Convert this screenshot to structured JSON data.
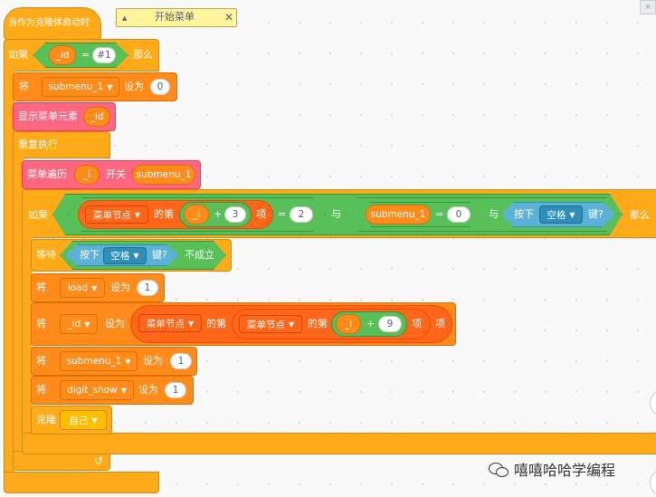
{
  "top_right_icon": "close-icon",
  "hat": {
    "label": "当作为克隆体启动时"
  },
  "comment": {
    "text": "开始菜单",
    "collapse_icon": "triangle-up-icon",
    "close_icon": "close-icon"
  },
  "if1": {
    "label": "如果",
    "var": "_id",
    "eq": "=",
    "value": "#1",
    "then": "那么"
  },
  "set1": {
    "label": "将",
    "var": "submenu_1",
    "to": "设为",
    "value": "0"
  },
  "show": {
    "label": "显示菜单元素",
    "arg": "_id"
  },
  "forever": {
    "label": "重复执行"
  },
  "menu_loop": {
    "label": "菜单遍历",
    "arg": "_i",
    "switch": "开关",
    "target": "submenu_1"
  },
  "if2": {
    "label": "如果",
    "list": "菜单节点",
    "of": "的第",
    "i": "_i",
    "plus": "+",
    "n": "3",
    "item": "项",
    "eq": "=",
    "eqval": "2",
    "and1": "与",
    "var": "submenu_1",
    "eq2": "=",
    "zero": "0",
    "and2": "与",
    "press": "按下",
    "key": "空格",
    "key_suffix": "键?",
    "then": "那么"
  },
  "wait": {
    "label": "等待",
    "press": "按下",
    "key": "空格",
    "key_suffix": "键?",
    "not": "不成立"
  },
  "set_load": {
    "label": "将",
    "var": "load",
    "to": "设为",
    "value": "1"
  },
  "set_id": {
    "label": "将",
    "var": "_id",
    "to": "设为",
    "list1": "菜单节点",
    "of1": "的第",
    "list2": "菜单节点",
    "of2": "的第",
    "i": "_i",
    "plus": "+",
    "n": "9",
    "item1": "项",
    "item2": "项"
  },
  "set_sub": {
    "label": "将",
    "var": "submenu_1",
    "to": "设为",
    "value": "1"
  },
  "set_digit": {
    "label": "将",
    "var": "digit_show",
    "to": "设为",
    "value": "1"
  },
  "clone": {
    "label": "克隆",
    "target": "自己"
  },
  "loop_icon": "loop-arrow-icon",
  "dropdown_icon": "triangle-down-icon",
  "watermark": {
    "text": "嘻嘻哈哈学编程",
    "icon": "wechat-icon"
  },
  "colors": {
    "control": "#ffab19",
    "variables": "#ff8c1a",
    "list": "#ff661a",
    "operators": "#59c059",
    "sensing": "#5cb1d6",
    "custom": "#ff6680"
  }
}
